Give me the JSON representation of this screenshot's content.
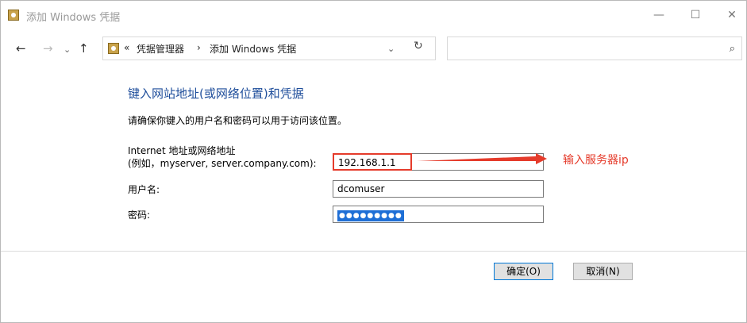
{
  "window": {
    "title": "添加 Windows 凭据"
  },
  "nav": {
    "back": "←",
    "forward": "→",
    "history": "⌄",
    "up": "↑",
    "breadcrumb": {
      "overflow": "«",
      "item1": "凭据管理器",
      "sep": "›",
      "item2": "添加 Windows 凭据"
    },
    "refresh": "↻",
    "search_placeholder": ""
  },
  "content": {
    "heading": "键入网站地址(或网络位置)和凭据",
    "subtitle": "请确保你键入的用户名和密码可以用于访问该位置。",
    "address_label_line1": "Internet 地址或网络地址",
    "address_label_line2": "(例如，myserver, server.company.com):",
    "address_value": "192.168.1.1",
    "username_label": "用户名:",
    "username_value": "dcomuser",
    "password_label": "密码:",
    "password_value": "●●●●●●●●●"
  },
  "annotation": {
    "text": "输入服务器ip",
    "color": "#e53b2b"
  },
  "buttons": {
    "ok": "确定(O)",
    "cancel": "取消(N)"
  }
}
